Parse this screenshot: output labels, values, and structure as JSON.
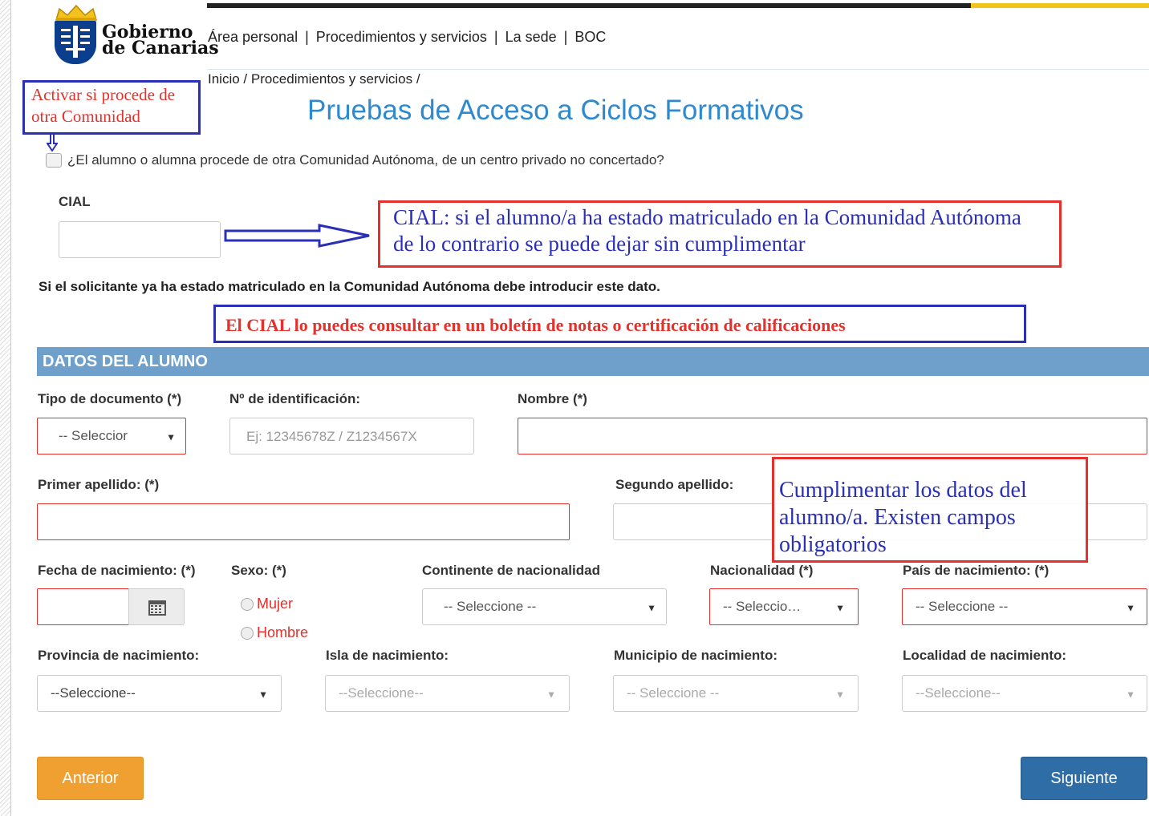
{
  "header": {
    "logo_text_line1": "Gobierno",
    "logo_text_line2": "de Canarias",
    "nav": [
      "Área personal",
      "Procedimientos y servicios",
      "La sede",
      "BOC"
    ],
    "nav_separator": "|"
  },
  "breadcrumb": "Inicio / Procedimientos y servicios /",
  "page_title": "Pruebas de Acceso a Ciclos Formativos",
  "annotations": {
    "activar": "Activar si procede de otra Comunidad",
    "cial": "CIAL: si el alumno/a ha estado matriculado en la Comunidad Autónoma de lo contrario se puede dejar sin cumplimentar",
    "cial_consulta": "El CIAL lo puedes consultar en un boletín de notas o certificación de calificaciones",
    "cumplimentar": "Cumplimentar los datos del alumno/a. Existen campos obligatorios"
  },
  "other_community_checkbox": {
    "label": "¿El alumno o alumna procede de otra Comunidad Autónoma, de un centro privado no concertado?",
    "checked": false
  },
  "cial": {
    "label": "CIAL",
    "value": "",
    "note": "Si el solicitante ya ha estado matriculado en la Comunidad Autónoma debe introducir este dato."
  },
  "section_title": "DATOS DEL ALUMNO",
  "form": {
    "tipo_documento": {
      "label": "Tipo de documento (*)",
      "value": "-- Seleccior"
    },
    "num_identificacion": {
      "label": "Nº de identificación:",
      "placeholder": "Ej: 12345678Z / Z1234567X"
    },
    "nombre": {
      "label": "Nombre (*)",
      "value": ""
    },
    "primer_apellido": {
      "label": "Primer apellido: (*)",
      "value": ""
    },
    "segundo_apellido": {
      "label": "Segundo apellido:",
      "value": ""
    },
    "fecha_nacimiento": {
      "label": "Fecha de nacimiento: (*)",
      "value": ""
    },
    "sexo": {
      "label": "Sexo: (*)",
      "options": [
        "Mujer",
        "Hombre"
      ]
    },
    "continente": {
      "label": "Continente de nacionalidad",
      "value": "-- Seleccione --"
    },
    "nacionalidad": {
      "label": "Nacionalidad (*)",
      "value": "-- Seleccio…"
    },
    "pais_nacimiento": {
      "label": "País de nacimiento: (*)",
      "value": "-- Seleccione --"
    },
    "provincia": {
      "label": "Provincia de nacimiento:",
      "value": "--Seleccione--"
    },
    "isla": {
      "label": "Isla de nacimiento:",
      "value": "--Seleccione--"
    },
    "municipio": {
      "label": "Municipio de nacimiento:",
      "value": "-- Seleccione --"
    },
    "localidad": {
      "label": "Localidad de nacimiento:",
      "value": "--Seleccione--"
    }
  },
  "buttons": {
    "prev": "Anterior",
    "next": "Siguiente"
  },
  "colors": {
    "title_blue": "#2f89cf",
    "section_blue": "#6f9fcb",
    "annotation_red": "#e5302b",
    "annotation_blue": "#2a2fb8",
    "btn_orange": "#f0a031",
    "btn_blue": "#2f6da6"
  }
}
